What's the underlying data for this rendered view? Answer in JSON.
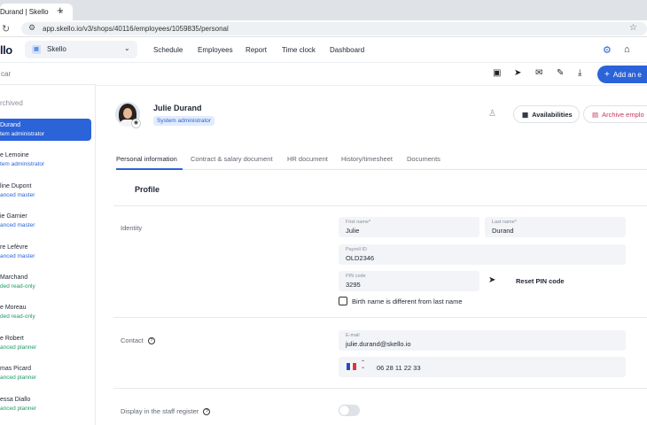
{
  "browser": {
    "tab_title": "Durand | Skello",
    "tab_close": "×",
    "new_tab": "+",
    "back": "←",
    "forward": "→",
    "reload": "↻",
    "url": "app.skello.io/v3/shops/40116/employees/1059835/personal"
  },
  "app": {
    "logo": "llo",
    "shop_name": "Skello",
    "nav": [
      "Schedule",
      "Employees",
      "Report",
      "Time clock",
      "Dashboard"
    ]
  },
  "sidebar": {
    "search_placeholder": "car",
    "archived_label": "rchived",
    "employees": [
      {
        "name": "Durand",
        "role": "tem administrator",
        "role_color": "#ffffff",
        "active": true
      },
      {
        "name": "e Lemoine",
        "role": "tem administrator",
        "role_color": "#2b63d9",
        "active": false
      },
      {
        "name": "line Dupont",
        "role": "anced master",
        "role_color": "#2b63d9",
        "active": false
      },
      {
        "name": "ie Garnier",
        "role": "anced master",
        "role_color": "#2b63d9",
        "active": false
      },
      {
        "name": "re Lefèvre",
        "role": "anced master",
        "role_color": "#2b63d9",
        "active": false
      },
      {
        "name": "Marchand",
        "role": "ded read-only",
        "role_color": "#1f9a6a",
        "active": false
      },
      {
        "name": "e Moreau",
        "role": "ded read-only",
        "role_color": "#1f9a6a",
        "active": false
      },
      {
        "name": "e Robert",
        "role": "anced planner",
        "role_color": "#1f9a6a",
        "active": false
      },
      {
        "name": "mas Picard",
        "role": "anced planner",
        "role_color": "#1f9a6a",
        "active": false
      },
      {
        "name": "essa Diallo",
        "role": "anced planner",
        "role_color": "#1f9a6a",
        "active": false
      }
    ]
  },
  "toolbar": {
    "add_label": "Add an e"
  },
  "profile": {
    "name": "Julie Durand",
    "role_badge": "System administrator",
    "availabilities_label": "Availabilities",
    "archive_label": "Archive emplo"
  },
  "tabs": [
    "Personal information",
    "Contract & salary document",
    "HR document",
    "History/timesheet",
    "Documents"
  ],
  "form": {
    "section_title": "Profile",
    "identity_label": "Identity",
    "first_name_label": "First name*",
    "first_name": "Julie",
    "last_name_label": "Last name*",
    "last_name": "Durand",
    "payroll_label": "Payroll ID",
    "payroll_id": "OLD2346",
    "pin_label": "PIN code",
    "pin": "3295",
    "reset_pin": "Reset PIN code",
    "birth_name_checkbox": "Birth name is different from last name",
    "contact_label": "Contact",
    "email_label": "E-mail",
    "email": "julie.durand@skello.io",
    "phone": "06 28 11 22 33",
    "register_label": "Display in the staff register"
  },
  "colors": {
    "accent": "#2b63d9",
    "archive": "#c6345a"
  }
}
